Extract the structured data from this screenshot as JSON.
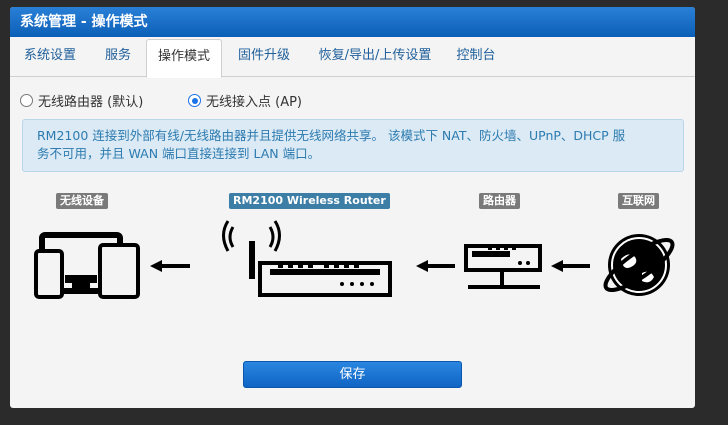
{
  "window": {
    "title": "系统管理 - 操作模式"
  },
  "tabs": [
    {
      "label": "系统设置",
      "active": false
    },
    {
      "label": "服务",
      "active": false
    },
    {
      "label": "操作模式",
      "active": true
    },
    {
      "label": "固件升级",
      "active": false
    },
    {
      "label": "恢复/导出/上传设置",
      "active": false
    },
    {
      "label": "控制台",
      "active": false
    }
  ],
  "mode": {
    "options": [
      {
        "label": "无线路由器 (默认)",
        "checked": false
      },
      {
        "label": "无线接入点 (AP)",
        "checked": true
      }
    ]
  },
  "info": {
    "line1": "RM2100 连接到外部有线/无线路由器并且提供无线网络共享。 该模式下 NAT、防火墙、UPnP、DHCP 服",
    "line2": "务不可用，并且 WAN 端口直接连接到 LAN 端口。"
  },
  "diagram": {
    "devices_label": "无线设备",
    "router_label": "RM2100 Wireless Router",
    "upstream_label": "路由器",
    "internet_label": "互联网"
  },
  "actions": {
    "save_label": "保存"
  },
  "colors": {
    "accent": "#0b5fb8",
    "info_bg": "#dbeaf5",
    "info_text": "#2d7bb0",
    "router_label_bg": "#3d7ea6"
  }
}
